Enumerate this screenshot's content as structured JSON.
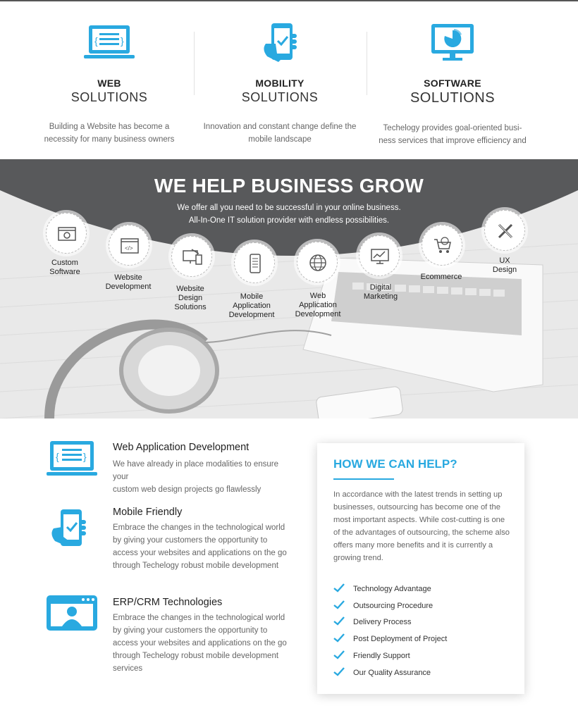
{
  "services": [
    {
      "title": "WEB",
      "subtitle": "SOLUTIONS",
      "line1": "Building a Website has become a",
      "line2": "necessity for many business owners"
    },
    {
      "title": "MOBILITY",
      "subtitle": "SOLUTIONS",
      "line1": "Innovation and constant change define the",
      "line2": "mobile landscape"
    },
    {
      "title": "SOFTWARE",
      "subtitle": "SOLUTIONS",
      "line1": "Techelogy provides goal-oriented busi-",
      "line2": "ness services that improve efficiency and"
    }
  ],
  "grow": {
    "heading": "WE HELP BUSINESS GROW",
    "line1": "We offer all you need to be successful in your online business.",
    "line2": "All-In-One IT solution provider with endless possibilities.",
    "items": [
      {
        "l1": "Custom",
        "l2": "Software",
        "l3": "",
        "icon": "settings-window-icon"
      },
      {
        "l1": "Website",
        "l2": "Development",
        "l3": "",
        "icon": "code-window-icon"
      },
      {
        "l1": "Website",
        "l2": "Design",
        "l3": "Solutions",
        "icon": "design-devices-icon"
      },
      {
        "l1": "Mobile",
        "l2": "Application",
        "l3": "Development",
        "icon": "mobile-app-icon"
      },
      {
        "l1": "Web",
        "l2": "Application",
        "l3": "Development",
        "icon": "globe-icon"
      },
      {
        "l1": "Digital",
        "l2": "Marketing",
        "l3": "",
        "icon": "chart-monitor-icon"
      },
      {
        "l1": "Ecommerce",
        "l2": "",
        "l3": "",
        "icon": "shopping-cart-icon"
      },
      {
        "l1": "UX",
        "l2": "Design",
        "l3": "",
        "icon": "pencil-ruler-icon"
      }
    ]
  },
  "features": [
    {
      "title": "Web Application Development",
      "lines": [
        "We have already in place modalities to ensure your",
        "custom web design projects go flawlessly"
      ]
    },
    {
      "title": "Mobile Friendly",
      "lines": [
        "Embrace the changes in the technological world",
        "by giving your customers the opportunity to",
        "access your websites and applications on the go",
        "through Techelogy robust mobile development"
      ]
    },
    {
      "title": "ERP/CRM Technologies",
      "lines": [
        "Embrace the changes in the technological world",
        "by giving your customers the opportunity to",
        "access your websites and applications on the go",
        "through Techelogy robust mobile development",
        "services"
      ]
    }
  ],
  "help": {
    "heading": "HOW WE CAN HELP?",
    "lines": [
      "In accordance with the latest trends in setting up",
      "businesses, outsourcing has become one of the",
      "most important aspects. While cost-cutting is one",
      "of the advantages of outsourcing, the scheme also",
      "offers many more benefits and it is currently a",
      "growing trend."
    ],
    "checklist": [
      "Technology Advantage",
      "Outsourcing Procedure",
      "Delivery Process",
      "Post Deployment of Project",
      "Friendly Support",
      "Our Quality Assurance"
    ]
  },
  "colors": {
    "accent": "#29a9e0",
    "band": "#58595b"
  }
}
